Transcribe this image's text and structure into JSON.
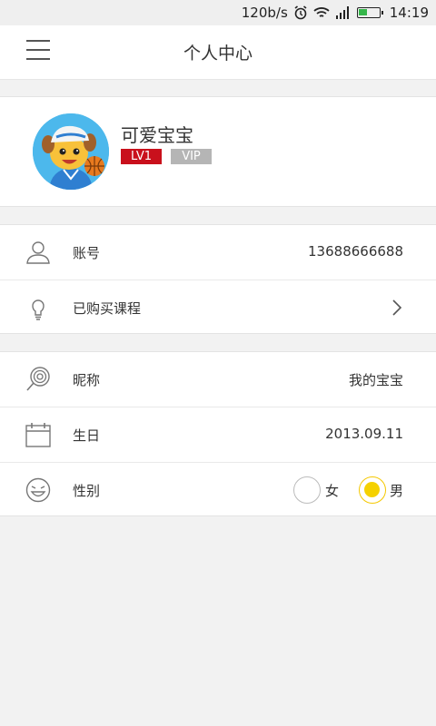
{
  "status_bar": {
    "speed": "120b/s",
    "time": "14:19",
    "icons": [
      "alarm-icon",
      "wifi-icon",
      "signal-icon",
      "battery-icon"
    ]
  },
  "header": {
    "title": "个人中心",
    "menu_icon": "menu-icon"
  },
  "profile": {
    "nickname": "可爱宝宝",
    "level_badge": "LV1",
    "vip_badge": "VIP",
    "colors": {
      "level": "#c9101c",
      "vip": "#b5b5b5"
    }
  },
  "rows": {
    "account": {
      "label": "账号",
      "value": "13688666688",
      "icon": "user-icon"
    },
    "courses": {
      "label": "已购买课程",
      "icon": "lightbulb-icon",
      "action_icon": "chevron-right-icon"
    },
    "nickname": {
      "label": "昵称",
      "value": "我的宝宝",
      "icon": "lollipop-icon"
    },
    "birthday": {
      "label": "生日",
      "value": "2013.09.11",
      "icon": "calendar-icon"
    },
    "gender": {
      "label": "性别",
      "icon": "smiley-icon",
      "options": [
        {
          "label": "女",
          "selected": false
        },
        {
          "label": "男",
          "selected": true
        }
      ],
      "accent": "#f5d100"
    }
  }
}
